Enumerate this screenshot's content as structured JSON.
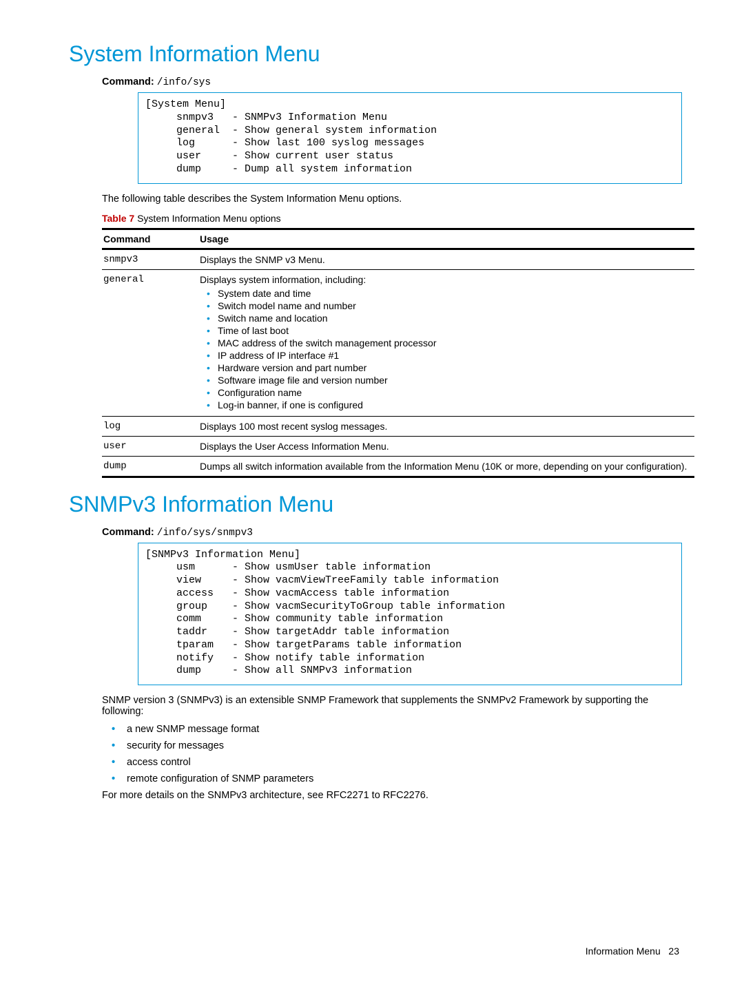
{
  "section1": {
    "heading": "System Information Menu",
    "command_label": "Command:",
    "command_value": "/info/sys",
    "codebox": "[System Menu]\n     snmpv3   - SNMPv3 Information Menu\n     general  - Show general system information\n     log      - Show last 100 syslog messages\n     user     - Show current user status\n     dump     - Dump all system information",
    "intro": "The following table describes the System Information Menu options.",
    "table_caption_prefix": "Table 7",
    "table_caption_rest": " System Information Menu options",
    "table_head_cmd": "Command",
    "table_head_usage": "Usage",
    "row_snmpv3_cmd": "snmpv3",
    "row_snmpv3_usage": "Displays the SNMP v3 Menu.",
    "row_general_cmd": "general",
    "row_general_usage_intro": "Displays system information, including:",
    "row_general_items": [
      "System date and time",
      "Switch model name and number",
      "Switch name and location",
      "Time of last boot",
      "MAC address of the switch management processor",
      "IP address of IP interface #1",
      "Hardware version and part number",
      "Software image file and version number",
      "Configuration name",
      "Log-in banner, if one is configured"
    ],
    "row_log_cmd": "log",
    "row_log_usage": "Displays 100 most recent syslog messages.",
    "row_user_cmd": "user",
    "row_user_usage": "Displays the User Access Information Menu.",
    "row_dump_cmd": "dump",
    "row_dump_usage": "Dumps all switch information available from the Information Menu (10K or more, depending on your configuration)."
  },
  "section2": {
    "heading": "SNMPv3 Information Menu",
    "command_label": "Command:",
    "command_value": "/info/sys/snmpv3",
    "codebox": "[SNMPv3 Information Menu]\n     usm      - Show usmUser table information\n     view     - Show vacmViewTreeFamily table information\n     access   - Show vacmAccess table information\n     group    - Show vacmSecurityToGroup table information\n     comm     - Show community table information\n     taddr    - Show targetAddr table information\n     tparam   - Show targetParams table information\n     notify   - Show notify table information\n     dump     - Show all SNMPv3 information",
    "intro": "SNMP version 3 (SNMPv3) is an extensible SNMP Framework that supplements the SNMPv2 Framework by supporting the following:",
    "features": [
      "a new SNMP message format",
      "security for messages",
      "access control",
      "remote configuration of SNMP parameters"
    ],
    "outro": "For more details on the SNMPv3 architecture, see RFC2271 to RFC2276."
  },
  "footer": {
    "text": "Information Menu",
    "page": "23"
  }
}
